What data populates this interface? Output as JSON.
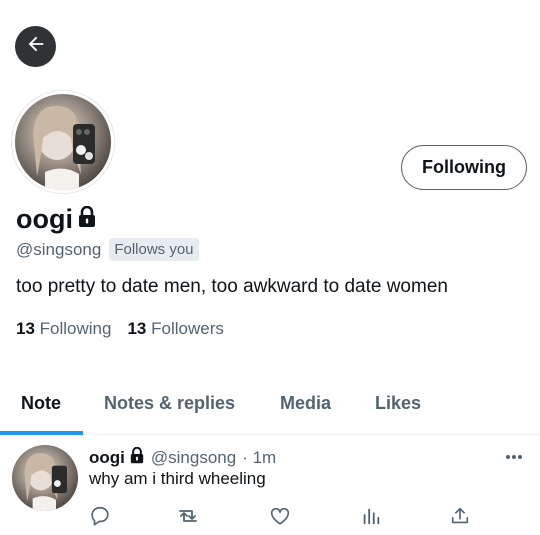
{
  "profile": {
    "display_name": "oogi",
    "handle": "@singsong",
    "follows_you": "Follows you",
    "bio": "too pretty to date men, too awkward to date women",
    "following_count": "13",
    "following_label": "Following",
    "followers_count": "13",
    "followers_label": "Followers",
    "follow_button": "Following"
  },
  "tabs": [
    {
      "label": "Note",
      "active": true
    },
    {
      "label": "Notes & replies",
      "active": false
    },
    {
      "label": "Media",
      "active": false
    },
    {
      "label": "Likes",
      "active": false
    }
  ],
  "tweet": {
    "name": "oogi",
    "handle": "@singsong",
    "time": "· 1m",
    "text": "why am i third wheeling"
  },
  "colors": {
    "accent": "#1d9bf0",
    "text_primary": "#0f1419",
    "text_secondary": "#536471"
  },
  "icons": [
    "back-arrow-icon",
    "lock-icon",
    "more-icon",
    "reply-icon",
    "retweet-icon",
    "like-icon",
    "views-icon",
    "share-icon"
  ]
}
